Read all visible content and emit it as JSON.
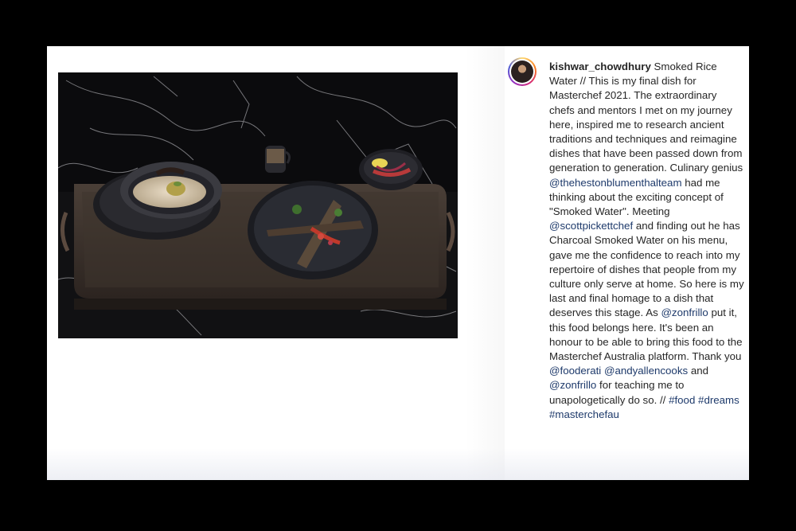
{
  "post": {
    "username": "kishwar_chowdhury",
    "caption_segments": [
      {
        "text": "Smoked Rice Water // This is my final dish for Masterchef 2021. The extraordinary chefs and mentors I met on my journey here, inspired me to research ancient traditions and techniques and reimagine dishes that have been passed down from generation to generation. Culinary genius ",
        "link": false
      },
      {
        "text": "@thehestonblumenthalteam",
        "link": true
      },
      {
        "text": " had me thinking about the exciting concept of \"Smoked Water\". Meeting ",
        "link": false
      },
      {
        "text": "@scottpickettchef",
        "link": true
      },
      {
        "text": " and finding out he has Charcoal Smoked Water on his menu, gave me the confidence to reach into my repertoire of dishes that people from my culture only serve at home. So here is my last and final homage to a dish that deserves this stage. As ",
        "link": false
      },
      {
        "text": "@zonfrillo",
        "link": true
      },
      {
        "text": " put it, this food belongs here. It's been an honour to be able to bring this food to the Masterchef Australia platform. Thank you ",
        "link": false
      },
      {
        "text": "@fooderati",
        "link": true
      },
      {
        "text": " ",
        "link": false
      },
      {
        "text": "@andyallencooks",
        "link": true
      },
      {
        "text": " and ",
        "link": false
      },
      {
        "text": "@zonfrillo",
        "link": true
      },
      {
        "text": " for teaching me to unapologetically do so. // ",
        "link": false
      },
      {
        "text": "#food",
        "link": true
      },
      {
        "text": " ",
        "link": false
      },
      {
        "text": "#dreams",
        "link": true
      },
      {
        "text": " ",
        "link": false
      },
      {
        "text": "#masterchefau",
        "link": true
      }
    ]
  },
  "colors": {
    "background": "#000000",
    "card": "#ffffff",
    "text": "#262626",
    "link": "#1e3a6b"
  },
  "icons": {
    "avatar": "profile-avatar"
  }
}
